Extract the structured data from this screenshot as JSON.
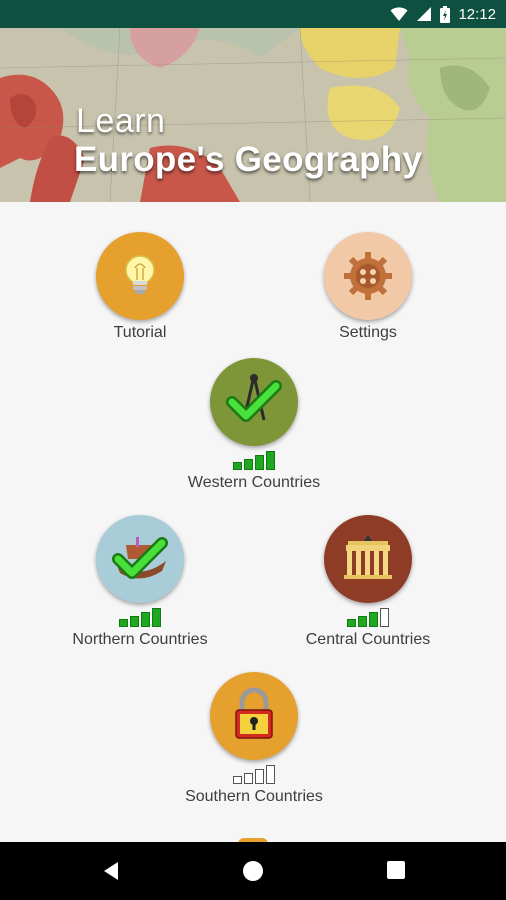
{
  "status_bar": {
    "time": "12:12"
  },
  "header": {
    "title_line1": "Learn",
    "title_line2": "Europe's Geography"
  },
  "tiles": {
    "tutorial": {
      "label": "Tutorial",
      "color": "#e6a02d"
    },
    "settings": {
      "label": "Settings",
      "color": "#f2c9a6"
    },
    "western": {
      "label": "Western Countries",
      "color": "#7e9638",
      "progress": [
        true,
        true,
        true,
        true
      ]
    },
    "northern": {
      "label": "Northern Countries",
      "color": "#a9cdd8",
      "progress": [
        true,
        true,
        true,
        true
      ]
    },
    "central": {
      "label": "Central Countries",
      "color": "#8f3c26",
      "progress": [
        true,
        true,
        true,
        false
      ]
    },
    "southern": {
      "label": "Southern Countries",
      "color": "#e6a02d",
      "progress": [
        false,
        false,
        false,
        false
      ]
    }
  },
  "icons": {
    "tutorial": "lightbulb-icon",
    "settings": "gear-icon",
    "western": "checkmark-compass-icon",
    "northern": "checkmark-ship-icon",
    "central": "brandenburg-gate-icon",
    "southern": "padlock-icon"
  }
}
